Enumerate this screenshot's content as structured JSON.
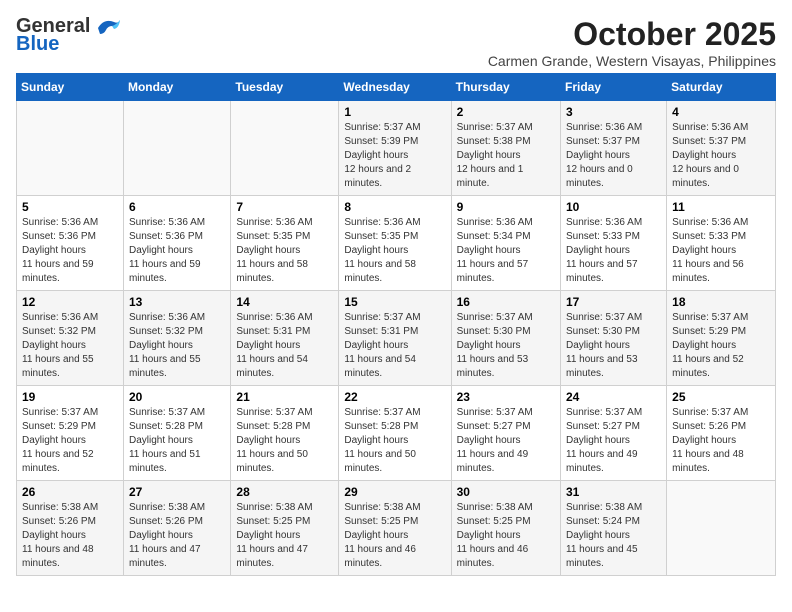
{
  "logo": {
    "line1": "General",
    "line2": "Blue"
  },
  "title": "October 2025",
  "location": "Carmen Grande, Western Visayas, Philippines",
  "days_of_week": [
    "Sunday",
    "Monday",
    "Tuesday",
    "Wednesday",
    "Thursday",
    "Friday",
    "Saturday"
  ],
  "weeks": [
    [
      {
        "day": "",
        "info": ""
      },
      {
        "day": "",
        "info": ""
      },
      {
        "day": "",
        "info": ""
      },
      {
        "day": "1",
        "sunrise": "5:37 AM",
        "sunset": "5:39 PM",
        "daylight": "12 hours and 2 minutes."
      },
      {
        "day": "2",
        "sunrise": "5:37 AM",
        "sunset": "5:38 PM",
        "daylight": "12 hours and 1 minute."
      },
      {
        "day": "3",
        "sunrise": "5:36 AM",
        "sunset": "5:37 PM",
        "daylight": "12 hours and 0 minutes."
      },
      {
        "day": "4",
        "sunrise": "5:36 AM",
        "sunset": "5:37 PM",
        "daylight": "12 hours and 0 minutes."
      }
    ],
    [
      {
        "day": "5",
        "sunrise": "5:36 AM",
        "sunset": "5:36 PM",
        "daylight": "11 hours and 59 minutes."
      },
      {
        "day": "6",
        "sunrise": "5:36 AM",
        "sunset": "5:36 PM",
        "daylight": "11 hours and 59 minutes."
      },
      {
        "day": "7",
        "sunrise": "5:36 AM",
        "sunset": "5:35 PM",
        "daylight": "11 hours and 58 minutes."
      },
      {
        "day": "8",
        "sunrise": "5:36 AM",
        "sunset": "5:35 PM",
        "daylight": "11 hours and 58 minutes."
      },
      {
        "day": "9",
        "sunrise": "5:36 AM",
        "sunset": "5:34 PM",
        "daylight": "11 hours and 57 minutes."
      },
      {
        "day": "10",
        "sunrise": "5:36 AM",
        "sunset": "5:33 PM",
        "daylight": "11 hours and 57 minutes."
      },
      {
        "day": "11",
        "sunrise": "5:36 AM",
        "sunset": "5:33 PM",
        "daylight": "11 hours and 56 minutes."
      }
    ],
    [
      {
        "day": "12",
        "sunrise": "5:36 AM",
        "sunset": "5:32 PM",
        "daylight": "11 hours and 55 minutes."
      },
      {
        "day": "13",
        "sunrise": "5:36 AM",
        "sunset": "5:32 PM",
        "daylight": "11 hours and 55 minutes."
      },
      {
        "day": "14",
        "sunrise": "5:36 AM",
        "sunset": "5:31 PM",
        "daylight": "11 hours and 54 minutes."
      },
      {
        "day": "15",
        "sunrise": "5:37 AM",
        "sunset": "5:31 PM",
        "daylight": "11 hours and 54 minutes."
      },
      {
        "day": "16",
        "sunrise": "5:37 AM",
        "sunset": "5:30 PM",
        "daylight": "11 hours and 53 minutes."
      },
      {
        "day": "17",
        "sunrise": "5:37 AM",
        "sunset": "5:30 PM",
        "daylight": "11 hours and 53 minutes."
      },
      {
        "day": "18",
        "sunrise": "5:37 AM",
        "sunset": "5:29 PM",
        "daylight": "11 hours and 52 minutes."
      }
    ],
    [
      {
        "day": "19",
        "sunrise": "5:37 AM",
        "sunset": "5:29 PM",
        "daylight": "11 hours and 52 minutes."
      },
      {
        "day": "20",
        "sunrise": "5:37 AM",
        "sunset": "5:28 PM",
        "daylight": "11 hours and 51 minutes."
      },
      {
        "day": "21",
        "sunrise": "5:37 AM",
        "sunset": "5:28 PM",
        "daylight": "11 hours and 50 minutes."
      },
      {
        "day": "22",
        "sunrise": "5:37 AM",
        "sunset": "5:28 PM",
        "daylight": "11 hours and 50 minutes."
      },
      {
        "day": "23",
        "sunrise": "5:37 AM",
        "sunset": "5:27 PM",
        "daylight": "11 hours and 49 minutes."
      },
      {
        "day": "24",
        "sunrise": "5:37 AM",
        "sunset": "5:27 PM",
        "daylight": "11 hours and 49 minutes."
      },
      {
        "day": "25",
        "sunrise": "5:37 AM",
        "sunset": "5:26 PM",
        "daylight": "11 hours and 48 minutes."
      }
    ],
    [
      {
        "day": "26",
        "sunrise": "5:38 AM",
        "sunset": "5:26 PM",
        "daylight": "11 hours and 48 minutes."
      },
      {
        "day": "27",
        "sunrise": "5:38 AM",
        "sunset": "5:26 PM",
        "daylight": "11 hours and 47 minutes."
      },
      {
        "day": "28",
        "sunrise": "5:38 AM",
        "sunset": "5:25 PM",
        "daylight": "11 hours and 47 minutes."
      },
      {
        "day": "29",
        "sunrise": "5:38 AM",
        "sunset": "5:25 PM",
        "daylight": "11 hours and 46 minutes."
      },
      {
        "day": "30",
        "sunrise": "5:38 AM",
        "sunset": "5:25 PM",
        "daylight": "11 hours and 46 minutes."
      },
      {
        "day": "31",
        "sunrise": "5:38 AM",
        "sunset": "5:24 PM",
        "daylight": "11 hours and 45 minutes."
      },
      {
        "day": "",
        "info": ""
      }
    ]
  ],
  "labels": {
    "sunrise": "Sunrise:",
    "sunset": "Sunset:",
    "daylight": "Daylight hours"
  },
  "colors": {
    "header_bg": "#1565c0",
    "header_text": "#ffffff"
  }
}
